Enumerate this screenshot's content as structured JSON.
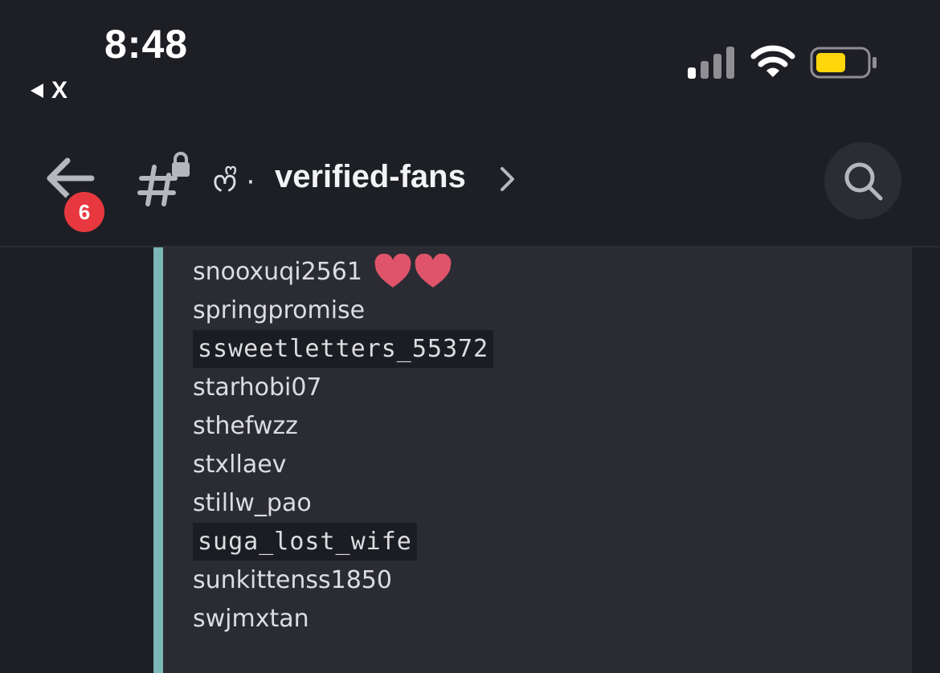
{
  "status_bar": {
    "time": "8:48",
    "back_app_label": "X"
  },
  "header": {
    "unread_count": "6",
    "channel_emoji": "ᰔᩚ ·",
    "channel_name": "verified-fans"
  },
  "members": [
    {
      "name": "snooxuqi2561",
      "style": "plain",
      "hearts": 2
    },
    {
      "name": "springpromise",
      "style": "plain"
    },
    {
      "name": "ssweetletters_55372",
      "style": "code"
    },
    {
      "name": "starhobi07",
      "style": "plain"
    },
    {
      "name": "sthefwzz",
      "style": "plain"
    },
    {
      "name": "stxllaev",
      "style": "plain"
    },
    {
      "name": "stillw_pao",
      "style": "plain"
    },
    {
      "name": "suga_lost_wife",
      "style": "code"
    },
    {
      "name": "sunkittenss1850",
      "style": "plain"
    },
    {
      "name": "swjmxtan",
      "style": "plain"
    }
  ],
  "colors": {
    "background": "#1e1f25",
    "embed_bg": "#2b2c33",
    "embed_accent": "#7ab7b5",
    "badge": "#e8383f",
    "heart": "#e0546b",
    "battery": "#ffd60a"
  },
  "icons": {
    "back": "arrow-left-icon",
    "channel": "locked-text-channel-icon",
    "chevron": "chevron-right-icon",
    "search": "search-icon"
  }
}
